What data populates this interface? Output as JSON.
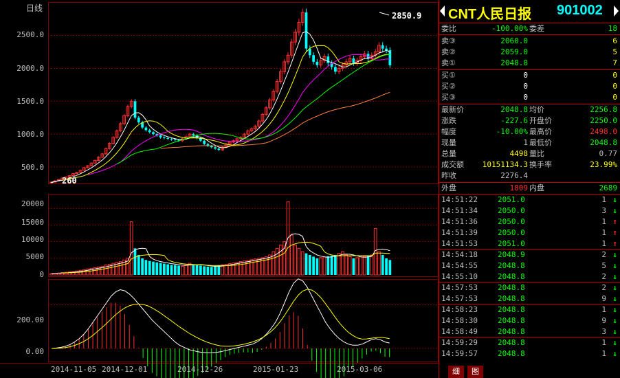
{
  "chart": {
    "period_label": "日线",
    "price_axis_ticks": [
      "2500.0",
      "2000.0",
      "1500.0",
      "1000.0",
      "500.0"
    ],
    "volume_axis_ticks": [
      "20000",
      "15000",
      "10000",
      "5000",
      "0"
    ],
    "macd_axis_ticks": [
      "200.00",
      "0.00"
    ],
    "date_ticks": [
      "2014-11-05",
      "2014-12-01",
      "2014-12-26",
      "2015-01-23",
      "2015-03-06"
    ],
    "max_label": "2850.9",
    "min_label": "260",
    "colors": {
      "up": "#ff3030",
      "down": "#00ffff",
      "ma5": "#ffffff",
      "ma10": "#ffff00",
      "ma20": "#ff00ff",
      "ma30": "#00ff00",
      "ma60": "#ff8040",
      "grid": "#800000"
    }
  },
  "chart_data": {
    "type": "candlestick",
    "price_ylim": [
      260,
      2850.9
    ],
    "volume_ylim": [
      0,
      24000
    ],
    "macd_ylim": [
      -60,
      300
    ],
    "close": [
      270,
      290,
      310,
      330,
      350,
      370,
      400,
      420,
      450,
      490,
      520,
      560,
      600,
      650,
      700,
      780,
      860,
      950,
      1050,
      1160,
      1280,
      1420,
      1500,
      1250,
      1180,
      1100,
      1060,
      1030,
      1000,
      980,
      950,
      940,
      930,
      920,
      910,
      900,
      930,
      960,
      1000,
      980,
      940,
      900,
      850,
      820,
      800,
      780,
      760,
      800,
      850,
      880,
      900,
      930,
      950,
      1000,
      1050,
      1080,
      1120,
      1200,
      1300,
      1400,
      1520,
      1650,
      1800,
      1950,
      2100,
      2200,
      2400,
      2550,
      2700,
      2850,
      2300,
      2200,
      2100,
      2050,
      2120,
      2180,
      2080,
      2020,
      1950,
      2000,
      2050,
      2100,
      2150,
      2080,
      2120,
      2180,
      2220,
      2150,
      2200,
      2250,
      2350,
      2300,
      2276,
      2048
    ],
    "volume": [
      400,
      500,
      600,
      700,
      800,
      900,
      1000,
      1200,
      1400,
      1600,
      1800,
      2000,
      2200,
      2400,
      2600,
      3000,
      3200,
      3500,
      3800,
      4000,
      4500,
      5000,
      16000,
      8000,
      6000,
      5000,
      4500,
      4200,
      4000,
      3800,
      3600,
      3400,
      3200,
      3000,
      3000,
      2800,
      2600,
      3000,
      3500,
      3200,
      3000,
      2800,
      2600,
      2500,
      2400,
      2600,
      2800,
      3000,
      3200,
      3400,
      3600,
      3800,
      4000,
      4200,
      4400,
      4600,
      4800,
      5000,
      5200,
      5500,
      6000,
      7000,
      8000,
      9000,
      10000,
      22000,
      12000,
      9000,
      8000,
      7000,
      6500,
      6000,
      5500,
      5000,
      5200,
      5400,
      5600,
      5800,
      6000,
      6500,
      7000,
      6000,
      5500,
      5000,
      5200,
      5400,
      5600,
      5800,
      6000,
      14000,
      7000,
      6000,
      5000,
      4498
    ],
    "macd_dif": [
      0,
      2,
      5,
      10,
      18,
      30,
      45,
      65,
      90,
      120,
      150,
      180,
      210,
      240,
      260,
      270,
      265,
      250,
      230,
      205,
      180,
      155,
      130,
      110,
      90,
      70,
      50,
      30,
      15,
      5,
      -5,
      -10,
      -15,
      -18,
      -20,
      -20,
      -18,
      -15,
      -10,
      -5,
      0,
      5,
      10,
      15,
      20,
      30,
      45,
      65,
      90,
      120,
      160,
      210,
      260,
      300,
      320,
      310,
      280,
      240,
      200,
      160,
      120,
      90,
      65,
      45,
      30,
      20,
      15,
      15,
      20,
      30,
      40,
      45,
      40,
      30,
      25
    ],
    "macd_dea": [
      0,
      1,
      2,
      4,
      8,
      14,
      22,
      32,
      45,
      60,
      78,
      96,
      115,
      135,
      155,
      172,
      186,
      196,
      202,
      204,
      202,
      196,
      186,
      174,
      160,
      145,
      130,
      114,
      99,
      85,
      71,
      59,
      48,
      38,
      29,
      22,
      16,
      12,
      10,
      10,
      12,
      15,
      19,
      24,
      30,
      38,
      48,
      61,
      77,
      97,
      122,
      152,
      184,
      217,
      245,
      264,
      272,
      268,
      254,
      232,
      205,
      176,
      146,
      118,
      94,
      74,
      59,
      48,
      43,
      44,
      47,
      50,
      51,
      49,
      45
    ],
    "title": "CNT人民日报 901002"
  },
  "quote": {
    "name": "CNT人民日报",
    "code": "901002",
    "weibi_label": "委比",
    "weibi_value": "-100.00%",
    "weicha_label": "委差",
    "weicha_value": "18",
    "sells": [
      {
        "label": "卖③",
        "price": "2060.0",
        "vol": "6"
      },
      {
        "label": "卖②",
        "price": "2059.0",
        "vol": "5"
      },
      {
        "label": "卖①",
        "price": "2048.8",
        "vol": "7"
      }
    ],
    "buys": [
      {
        "label": "买①",
        "price": "0",
        "vol": "0"
      },
      {
        "label": "买②",
        "price": "0",
        "vol": "0"
      },
      {
        "label": "买③",
        "price": "0",
        "vol": "0"
      }
    ],
    "stats": [
      {
        "l1": "最新价",
        "v1": "2048.8",
        "c1": "g",
        "l2": "均价",
        "v2": "2256.8",
        "c2": "g"
      },
      {
        "l1": "涨跌",
        "v1": "-227.6",
        "c1": "g",
        "l2": "开盘价",
        "v2": "2250.0",
        "c2": "g"
      },
      {
        "l1": "幅度",
        "v1": "-10.00%",
        "c1": "g",
        "l2": "最高价",
        "v2": "2498.0",
        "c2": "r"
      },
      {
        "l1": "现量",
        "v1": "1",
        "c1": "gr",
        "l2": "最低价",
        "v2": "2048.8",
        "c2": "g"
      },
      {
        "l1": "总量",
        "v1": "4498",
        "c1": "y",
        "l2": "量比",
        "v2": "0.77",
        "c2": "gr"
      },
      {
        "l1": "成交额",
        "v1": "10151134.3",
        "c1": "y",
        "l2": "换手率",
        "v2": "23.99%",
        "c2": "y"
      },
      {
        "l1": "昨收",
        "v1": "2276.4",
        "c1": "gr",
        "l2": "",
        "v2": "",
        "c2": "gr"
      }
    ],
    "waipan_label": "外盘",
    "waipan_value": "1809",
    "neipan_label": "内盘",
    "neipan_value": "2689"
  },
  "ticks": [
    {
      "time": "14:51:22",
      "price": "2051.0",
      "vol": "1",
      "dir": "↓",
      "color": "g"
    },
    {
      "time": "14:51:34",
      "price": "2050.0",
      "vol": "3",
      "dir": "↓",
      "color": "g"
    },
    {
      "time": "14:51:36",
      "price": "2050.0",
      "vol": "1",
      "dir": "↑",
      "color": "r"
    },
    {
      "time": "14:51:39",
      "price": "2050.0",
      "vol": "1",
      "dir": "↑",
      "color": "r"
    },
    {
      "time": "14:51:53",
      "price": "2051.0",
      "vol": "1",
      "dir": "↑",
      "color": "r"
    },
    {
      "time": "14:54:18",
      "price": "2048.9",
      "vol": "2",
      "dir": "↓",
      "color": "g"
    },
    {
      "time": "14:54:55",
      "price": "2048.8",
      "vol": "5",
      "dir": "↓",
      "color": "g"
    },
    {
      "time": "14:55:10",
      "price": "2048.8",
      "vol": "2",
      "dir": "↓",
      "color": "g"
    },
    {
      "time": "14:57:53",
      "price": "2048.8",
      "vol": "2",
      "dir": "↓",
      "color": "g"
    },
    {
      "time": "14:57:53",
      "price": "2048.8",
      "vol": "9",
      "dir": "↓",
      "color": "g"
    },
    {
      "time": "14:58:23",
      "price": "2048.8",
      "vol": "1",
      "dir": "↓",
      "color": "g"
    },
    {
      "time": "14:58:30",
      "price": "2048.8",
      "vol": "9",
      "dir": "↓",
      "color": "g"
    },
    {
      "time": "14:58:49",
      "price": "2048.8",
      "vol": "3",
      "dir": "↓",
      "color": "g"
    },
    {
      "time": "14:59:29",
      "price": "2048.8",
      "vol": "1",
      "dir": "↓",
      "color": "g"
    },
    {
      "time": "14:59:57",
      "price": "2048.8",
      "vol": "1",
      "dir": "↓",
      "color": "g"
    }
  ],
  "tabs": {
    "detail": "细",
    "chart": "图"
  }
}
